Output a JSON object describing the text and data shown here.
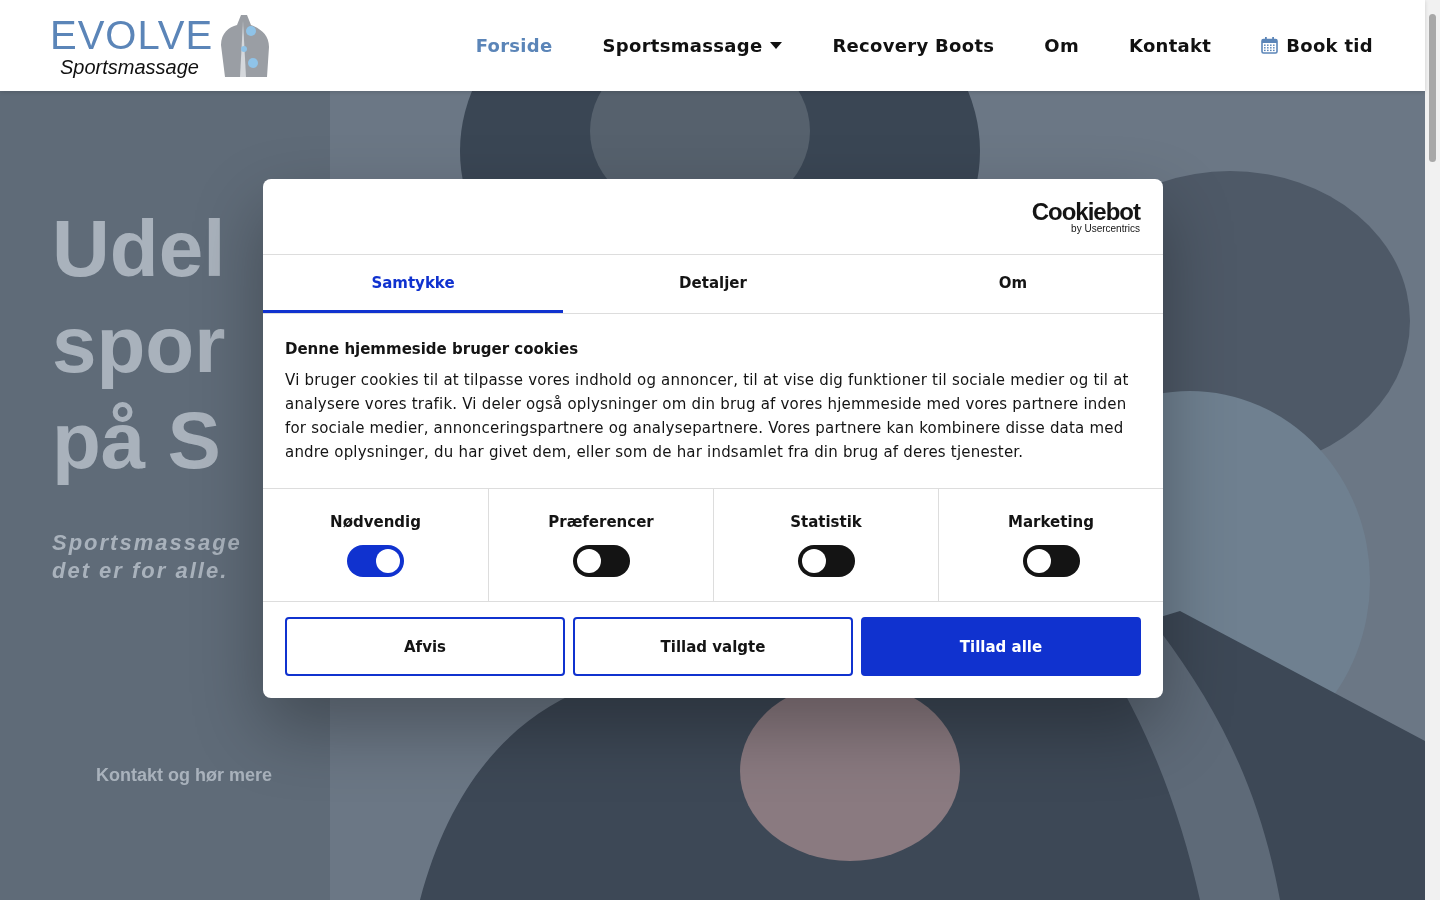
{
  "header": {
    "logo": {
      "title": "EVOLVE",
      "subtitle": "Sportsmassage"
    },
    "nav": [
      {
        "label": "Forside",
        "kind": "link",
        "selected": true
      },
      {
        "label": "Sportsmassage",
        "kind": "dropdown",
        "selected": false
      },
      {
        "label": "Recovery Boots",
        "kind": "link",
        "selected": false
      },
      {
        "label": "Om",
        "kind": "link",
        "selected": false
      },
      {
        "label": "Kontakt",
        "kind": "link",
        "selected": false
      },
      {
        "label": "Book tid",
        "kind": "booking",
        "selected": false
      }
    ]
  },
  "hero": {
    "heading": [
      "Udel",
      "spor",
      "på S"
    ],
    "subtitle": [
      "Sportsmassage",
      "det er for alle."
    ],
    "button": "Kontakt og hør mere"
  },
  "cookie_dialog": {
    "brand": {
      "name": "Cookiebot",
      "tagline": "by Usercentrics"
    },
    "tabs": [
      {
        "label": "Samtykke",
        "selected": true
      },
      {
        "label": "Detaljer",
        "selected": false
      },
      {
        "label": "Om",
        "selected": false
      }
    ],
    "title": "Denne hjemmeside bruger cookies",
    "text": "Vi bruger cookies til at tilpasse vores indhold og annoncer, til at vise dig funktioner til sociale medier og til at analysere vores trafik. Vi deler også oplysninger om din brug af vores hjemmeside med vores partnere inden for sociale medier, annonceringspartnere og analysepartnere. Vores partnere kan kombinere disse data med andre oplysninger, du har givet dem, eller som de har indsamlet fra din brug af deres tjenester.",
    "categories": [
      {
        "label": "Nødvendig",
        "on": true
      },
      {
        "label": "Præferencer",
        "on": false
      },
      {
        "label": "Statistik",
        "on": false
      },
      {
        "label": "Marketing",
        "on": false
      }
    ],
    "buttons": [
      {
        "label": "Afvis",
        "kind": "outline"
      },
      {
        "label": "Tillad valgte",
        "kind": "outline"
      },
      {
        "label": "Tillad alle",
        "kind": "primary"
      }
    ]
  }
}
